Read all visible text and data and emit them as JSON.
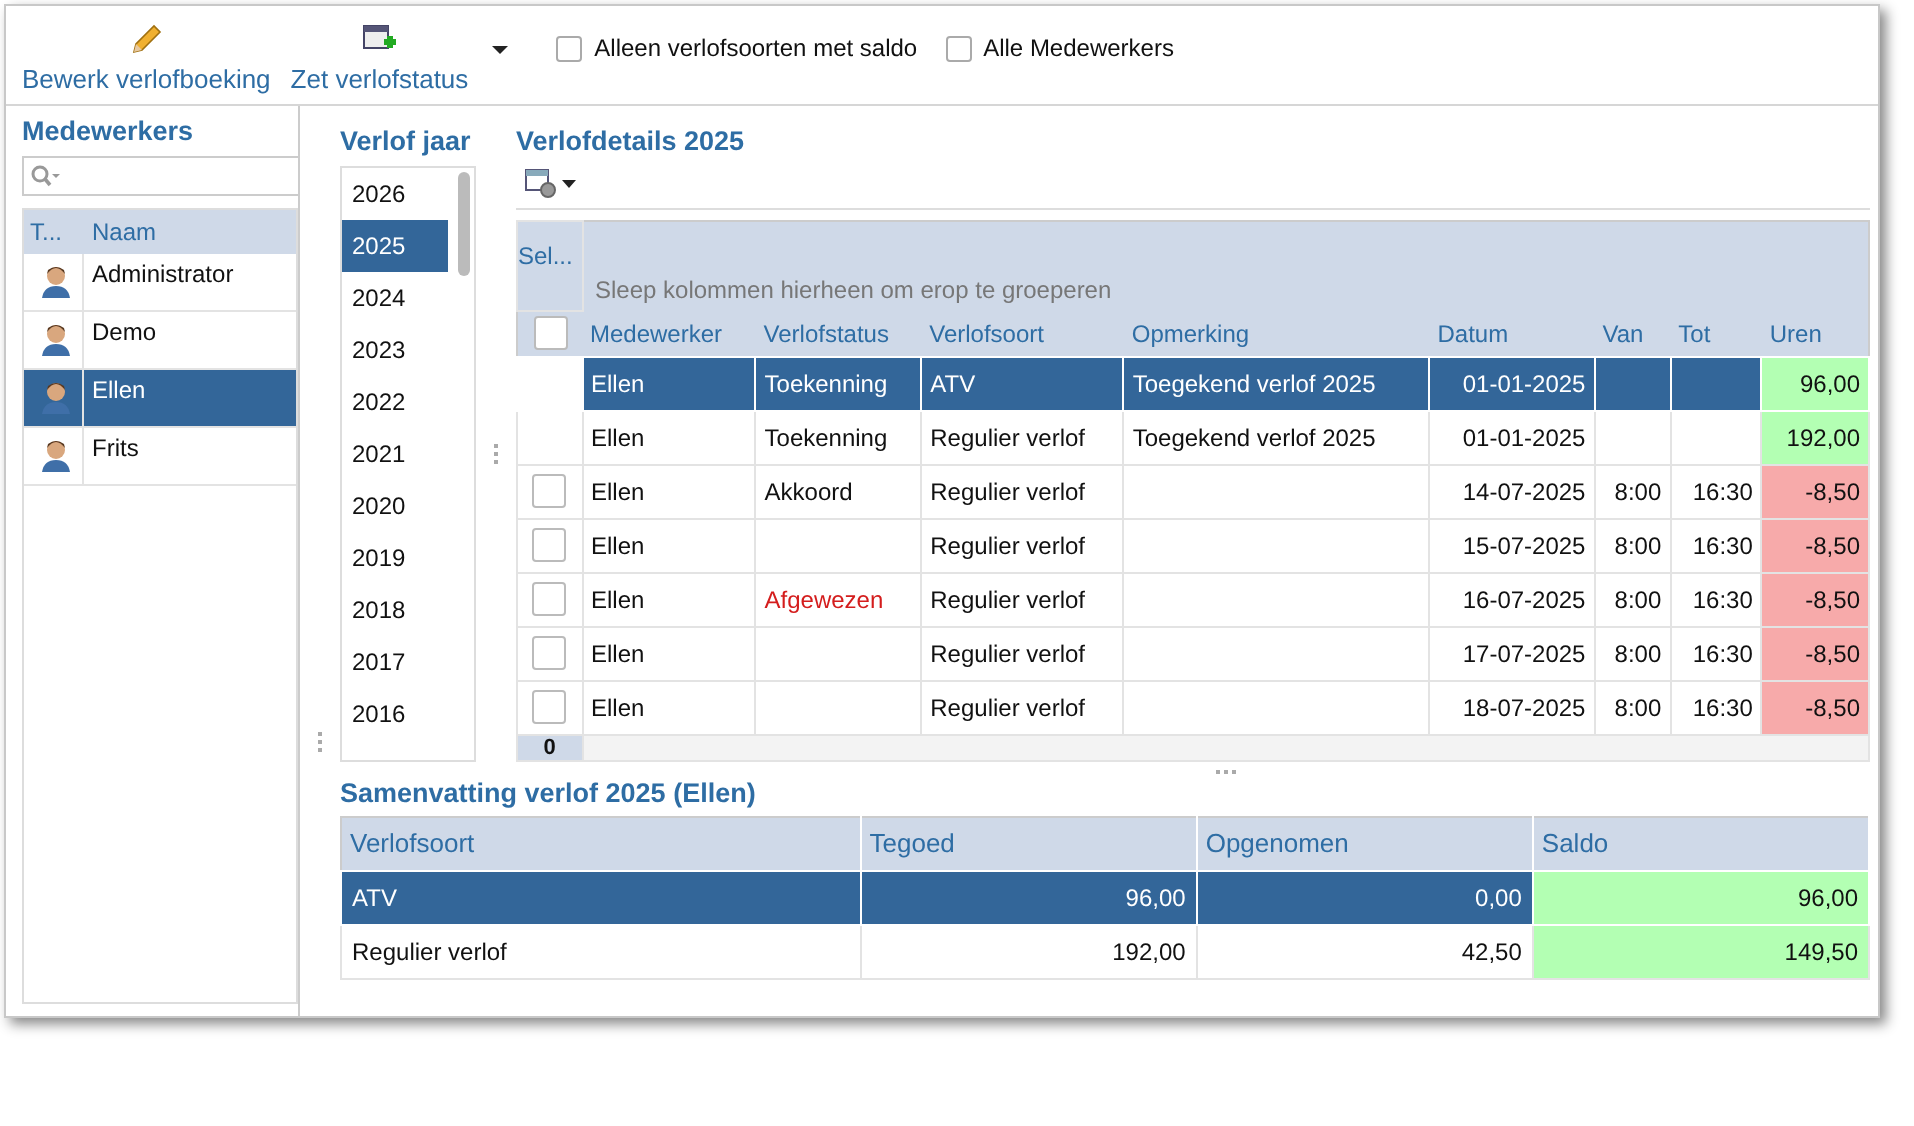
{
  "toolbar": {
    "buttons": [
      {
        "label": "Bewerk verlofboeking",
        "kind": "edit"
      },
      {
        "label": "Zet verlofstatus",
        "kind": "status",
        "dropdown": true
      }
    ],
    "checkboxes": [
      {
        "label": "Alleen verlofsoorten met saldo",
        "checked": false
      },
      {
        "label": "Alle Medewerkers",
        "checked": false
      }
    ]
  },
  "employees": {
    "title": "Medewerkers",
    "columns": [
      "T...",
      "Naam"
    ],
    "rows": [
      {
        "name": "Administrator",
        "selected": false
      },
      {
        "name": "Demo",
        "selected": false
      },
      {
        "name": "Ellen",
        "selected": true
      },
      {
        "name": "Frits",
        "selected": false
      }
    ]
  },
  "years": {
    "title": "Verlof jaar",
    "items": [
      {
        "label": "2026",
        "selected": false
      },
      {
        "label": "2025",
        "selected": true
      },
      {
        "label": "2024",
        "selected": false
      },
      {
        "label": "2023",
        "selected": false
      },
      {
        "label": "2022",
        "selected": false
      },
      {
        "label": "2021",
        "selected": false
      },
      {
        "label": "2020",
        "selected": false
      },
      {
        "label": "2019",
        "selected": false
      },
      {
        "label": "2018",
        "selected": false
      },
      {
        "label": "2017",
        "selected": false
      },
      {
        "label": "2016",
        "selected": false
      }
    ]
  },
  "details": {
    "title": "Verlofdetails 2025",
    "select_header": "Sel...",
    "select_all_checked": false,
    "group_hint": "Sleep kolommen hierheen om erop te groeperen",
    "footer_count": "0",
    "columns": [
      "Medewerker",
      "Verlofstatus",
      "Verlofsoort",
      "Opmerking",
      "Datum",
      "Van",
      "Tot",
      "Uren"
    ],
    "rows": [
      {
        "selected": true,
        "has_checkbox": false,
        "rejected": false,
        "color": "#b3ffb3",
        "cells": [
          "Ellen",
          "Toekenning",
          "ATV",
          "Toegekend verlof 2025",
          "01-01-2025",
          "",
          "",
          "96,00"
        ]
      },
      {
        "selected": false,
        "has_checkbox": false,
        "rejected": false,
        "color": "#b3ffb3",
        "cells": [
          "Ellen",
          "Toekenning",
          "Regulier verlof",
          "Toegekend verlof 2025",
          "01-01-2025",
          "",
          "",
          "192,00"
        ]
      },
      {
        "selected": false,
        "has_checkbox": true,
        "checked": false,
        "rejected": false,
        "color": "#f7aaaa",
        "cells": [
          "Ellen",
          "Akkoord",
          "Regulier verlof",
          "",
          "14-07-2025",
          "8:00",
          "16:30",
          "-8,50"
        ]
      },
      {
        "selected": false,
        "has_checkbox": true,
        "checked": false,
        "rejected": false,
        "color": "#f7aaaa",
        "cells": [
          "Ellen",
          "",
          "Regulier verlof",
          "",
          "15-07-2025",
          "8:00",
          "16:30",
          "-8,50"
        ]
      },
      {
        "selected": false,
        "has_checkbox": true,
        "checked": false,
        "rejected": true,
        "color": "#f7aaaa",
        "cells": [
          "Ellen",
          "Afgewezen",
          "Regulier verlof",
          "",
          "16-07-2025",
          "8:00",
          "16:30",
          "-8,50"
        ]
      },
      {
        "selected": false,
        "has_checkbox": true,
        "checked": false,
        "rejected": false,
        "color": "#f7aaaa",
        "cells": [
          "Ellen",
          "",
          "Regulier verlof",
          "",
          "17-07-2025",
          "8:00",
          "16:30",
          "-8,50"
        ]
      },
      {
        "selected": false,
        "has_checkbox": true,
        "checked": false,
        "rejected": false,
        "color": "#f7aaaa",
        "cells": [
          "Ellen",
          "",
          "Regulier verlof",
          "",
          "18-07-2025",
          "8:00",
          "16:30",
          "-8,50"
        ]
      }
    ]
  },
  "summary": {
    "title": "Samenvatting verlof 2025 (Ellen)",
    "columns": [
      "Verlofsoort",
      "Tegoed",
      "Opgenomen",
      "Saldo"
    ],
    "rows": [
      {
        "selected": true,
        "cells": [
          "ATV",
          "96,00",
          "0,00",
          "96,00"
        ]
      },
      {
        "selected": false,
        "cells": [
          "Regulier verlof",
          "192,00",
          "42,50",
          "149,50"
        ]
      }
    ]
  }
}
